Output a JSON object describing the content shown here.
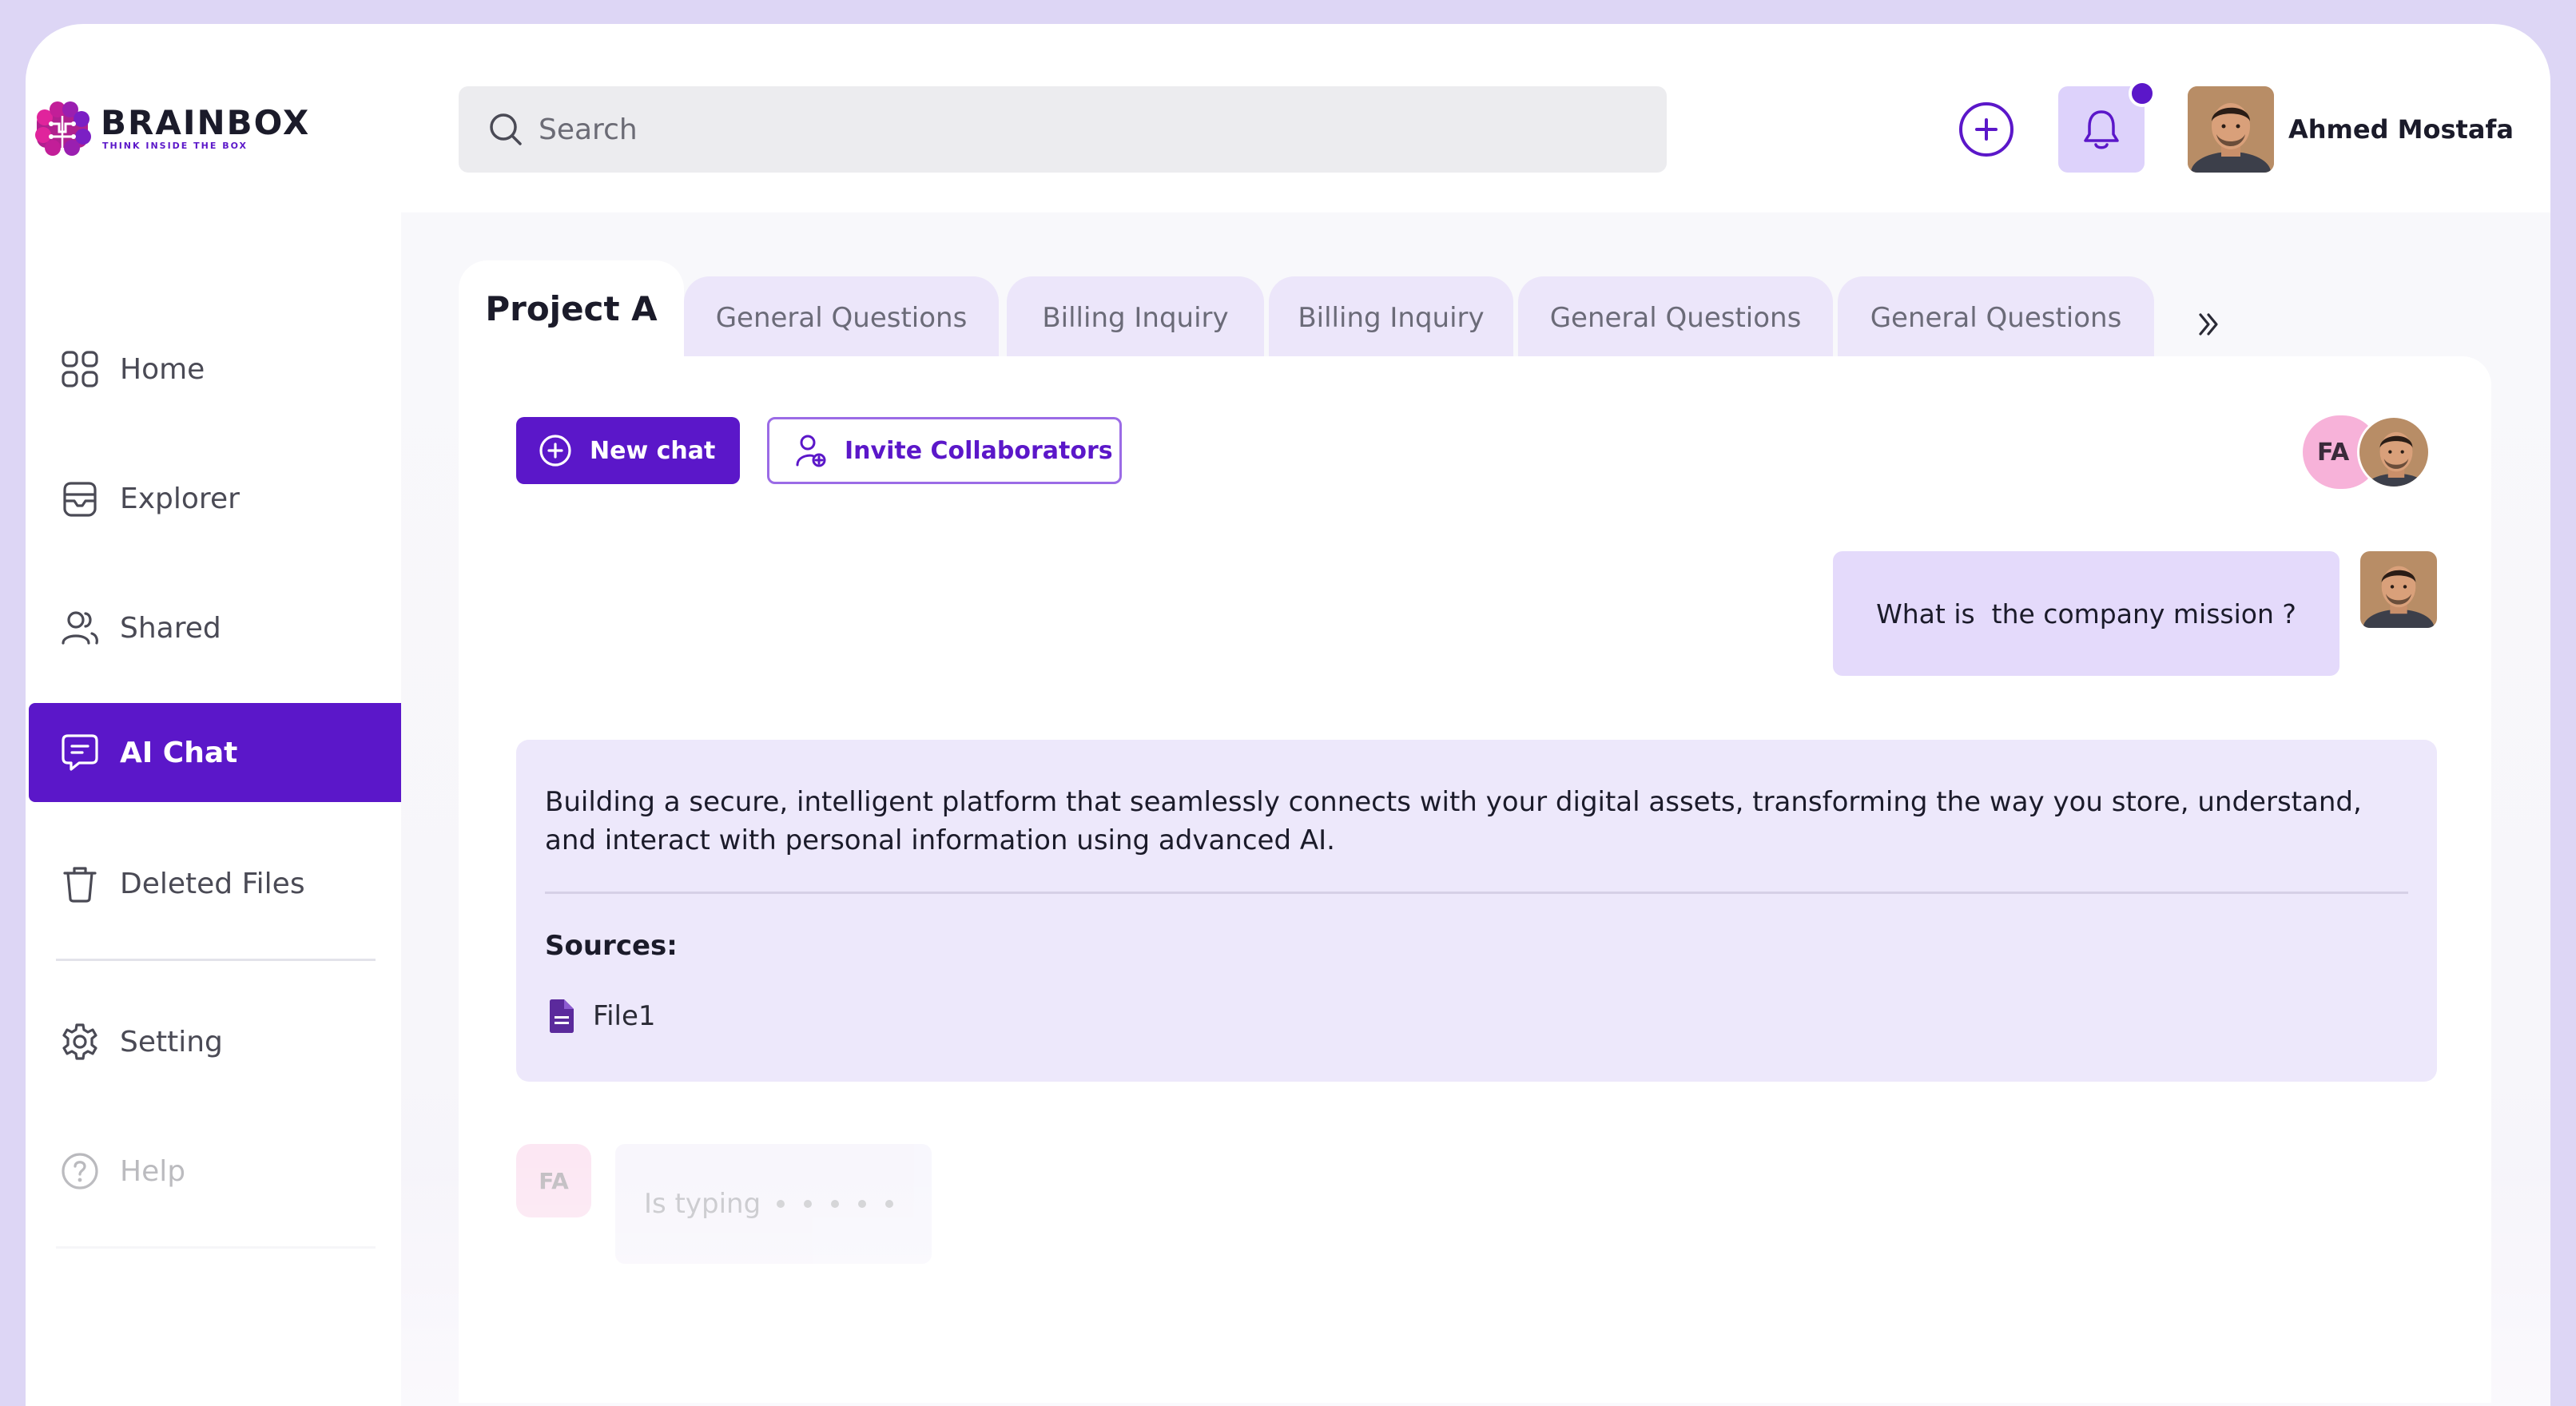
{
  "brand": {
    "name": "BRAINBOX",
    "tagline": "THINK INSIDE THE BOX",
    "colors": {
      "primary": "#5b17c9",
      "logo_pink": "#e0249c",
      "logo_purple": "#7b1fc4"
    }
  },
  "header": {
    "search": {
      "placeholder": "Search",
      "icon": "search-icon"
    },
    "add_icon": "plus-circle-icon",
    "notifications": {
      "icon": "bell-icon",
      "has_unread": true
    },
    "user": {
      "name": "Ahmed Mostafa",
      "avatar": "avatar"
    }
  },
  "sidebar": {
    "items": [
      {
        "label": "Home",
        "icon": "grid-icon",
        "active": false
      },
      {
        "label": "Explorer",
        "icon": "folder-icon",
        "active": false
      },
      {
        "label": "Shared",
        "icon": "users-icon",
        "active": false
      },
      {
        "label": "AI Chat",
        "icon": "chat-icon",
        "active": true
      },
      {
        "label": "Deleted Files",
        "icon": "trash-icon",
        "active": false
      }
    ],
    "secondary": [
      {
        "label": "Setting",
        "icon": "gear-icon"
      },
      {
        "label": "Help",
        "icon": "help-icon"
      }
    ]
  },
  "tabs": {
    "items": [
      {
        "label": "Project A",
        "active": true
      },
      {
        "label": "General Questions",
        "active": false
      },
      {
        "label": "Billing Inquiry",
        "active": false
      },
      {
        "label": "Billing Inquiry",
        "active": false
      },
      {
        "label": "General Questions",
        "active": false
      },
      {
        "label": "General Questions",
        "active": false
      }
    ],
    "more_icon": "double-chevron-right-icon"
  },
  "toolbar": {
    "new_chat_label": "New chat",
    "invite_label": "Invite Collaborators"
  },
  "collaborators": {
    "initials": "FA"
  },
  "chat": {
    "question": "What is  the company mission ?",
    "answer": "Building a secure, intelligent platform that seamlessly connects with your digital assets, transforming the way you store, understand, and interact with personal information using advanced AI.",
    "sources_label": "Sources:",
    "sources": [
      {
        "name": "File1",
        "icon": "document-icon"
      }
    ],
    "typing": {
      "initials": "FA",
      "label": "Is typing"
    }
  }
}
